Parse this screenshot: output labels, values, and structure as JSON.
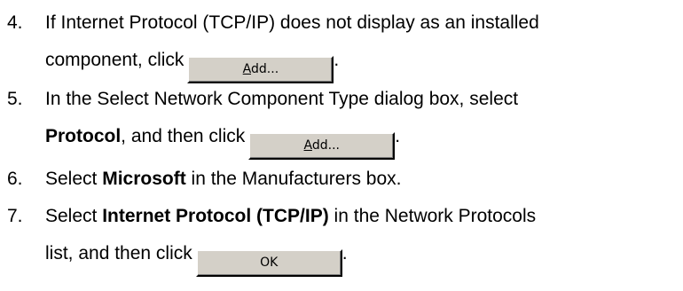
{
  "steps": [
    {
      "number": "4.",
      "line1": "If Internet Protocol (TCP/IP) does not display as an installed",
      "line2_text": "component, click",
      "button": {
        "mnemonic": "A",
        "rest": "dd..."
      },
      "trailing": "."
    },
    {
      "number": "5.",
      "line1": "In the Select Network Component Type dialog box, select",
      "line2_bold": "Protocol",
      "line2_text": ", and then click",
      "button": {
        "mnemonic": "A",
        "rest": "dd..."
      },
      "trailing": "."
    },
    {
      "number": "6.",
      "text_before": "Select ",
      "bold": "Microsoft",
      "text_after": " in the Manufacturers box."
    },
    {
      "number": "7.",
      "line1_before": "Select ",
      "line1_bold": "Internet Protocol (TCP/IP)",
      "line1_after": " in the Network Protocols",
      "line2_text": "list, and then click",
      "button": {
        "label": "OK"
      },
      "trailing": "."
    }
  ]
}
